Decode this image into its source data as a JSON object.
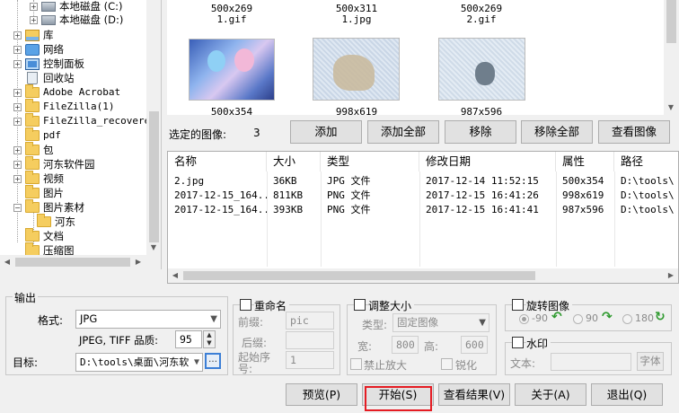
{
  "tree": {
    "items": [
      {
        "label": "本地磁盘 (C:)",
        "icon": "drive-icon"
      },
      {
        "label": "本地磁盘 (D:)",
        "icon": "drive-icon"
      },
      {
        "label": "库",
        "icon": "library-icon"
      },
      {
        "label": "网络",
        "icon": "network-icon"
      },
      {
        "label": "控制面板",
        "icon": "control-panel-icon"
      },
      {
        "label": "回收站",
        "icon": "recycle-bin-icon"
      },
      {
        "label": "Adobe Acrobat",
        "icon": "folder-icon"
      },
      {
        "label": "FileZilla(1)",
        "icon": "folder-icon"
      },
      {
        "label": "FileZilla_recovere",
        "icon": "folder-icon"
      },
      {
        "label": "pdf",
        "icon": "folder-icon"
      },
      {
        "label": "包",
        "icon": "folder-icon"
      },
      {
        "label": "河东软件园",
        "icon": "folder-icon"
      },
      {
        "label": "视频",
        "icon": "folder-icon"
      },
      {
        "label": "图片",
        "icon": "folder-icon"
      },
      {
        "label": "图片素材",
        "icon": "folder-icon"
      },
      {
        "label": "河东",
        "icon": "folder-icon"
      },
      {
        "label": "文档",
        "icon": "folder-icon"
      },
      {
        "label": "压缩图",
        "icon": "folder-icon"
      }
    ]
  },
  "gallery": {
    "top_row": [
      {
        "dims": "500x269",
        "name": "1.gif"
      },
      {
        "dims": "500x311",
        "name": "1.jpg"
      },
      {
        "dims": "500x269",
        "name": "2.gif"
      }
    ],
    "bottom_row": [
      {
        "dims": "500x354"
      },
      {
        "dims": "998x619"
      },
      {
        "dims": "987x596"
      }
    ]
  },
  "selection": {
    "label": "选定的图像:",
    "count": "3",
    "buttons": {
      "add": "添加",
      "add_all": "添加全部",
      "remove": "移除",
      "remove_all": "移除全部",
      "view": "查看图像"
    }
  },
  "file_list": {
    "headers": [
      "名称",
      "大小",
      "类型",
      "修改日期",
      "属性",
      "路径"
    ],
    "rows": [
      [
        "2.jpg",
        "36KB",
        "JPG 文件",
        "2017-12-14 11:52:15",
        "500x354",
        "D:\\tools\\"
      ],
      [
        "2017-12-15_164...",
        "811KB",
        "PNG 文件",
        "2017-12-15 16:41:26",
        "998x619",
        "D:\\tools\\"
      ],
      [
        "2017-12-15_164...",
        "393KB",
        "PNG 文件",
        "2017-12-15 16:41:41",
        "987x596",
        "D:\\tools\\"
      ]
    ]
  },
  "output": {
    "group": "输出",
    "format_label": "格式:",
    "format_value": "JPG",
    "quality_label": "JPEG, TIFF 品质:",
    "quality_value": "95",
    "target_label": "目标:",
    "target_value": "D:\\tools\\桌面\\河东软"
  },
  "rename": {
    "label": "重命名",
    "prefix_label": "前缀:",
    "prefix_value": "pic",
    "suffix_label": "后缀:",
    "start_label": "起始序号:",
    "start_value": "1"
  },
  "resize": {
    "label": "调整大小",
    "type_label": "类型:",
    "type_value": "固定图像",
    "width_label": "宽:",
    "width_value": "800",
    "height_label": "高:",
    "height_value": "600",
    "no_enlarge": "禁止放大",
    "sharpen": "锐化"
  },
  "rotate": {
    "label": "旋转图像",
    "options": [
      "-90",
      "90",
      "180"
    ]
  },
  "watermark": {
    "label": "水印",
    "text_label": "文本:",
    "font_button": "字体"
  },
  "actions": {
    "preview": "预览(P)",
    "start": "开始(S)",
    "results": "查看结果(V)",
    "about": "关于(A)",
    "exit": "退出(Q)"
  },
  "colors": {
    "highlight": "#e51c23",
    "rotate_arrow": "#2e9a2e"
  }
}
